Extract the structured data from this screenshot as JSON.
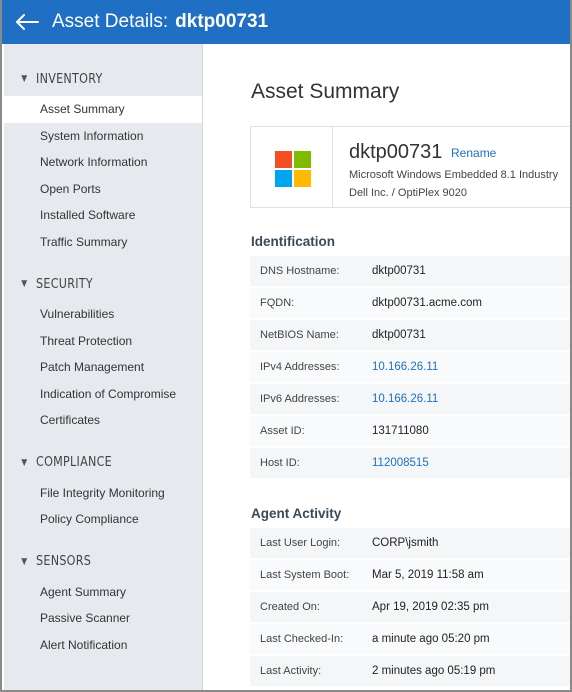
{
  "header": {
    "title_prefix": "Asset Details:",
    "asset_name": "dktp00731"
  },
  "sidebar": {
    "sections": [
      {
        "label": "INVENTORY",
        "items": [
          "Asset Summary",
          "System Information",
          "Network Information",
          "Open Ports",
          "Installed Software",
          "Traffic Summary"
        ]
      },
      {
        "label": "SECURITY",
        "items": [
          "Vulnerabilities",
          "Threat Protection",
          "Patch Management",
          "Indication of Compromise",
          "Certificates"
        ]
      },
      {
        "label": "COMPLIANCE",
        "items": [
          "File Integrity Monitoring",
          "Policy Compliance"
        ]
      },
      {
        "label": "SENSORS",
        "items": [
          "Agent Summary",
          "Passive Scanner",
          "Alert Notification"
        ]
      }
    ],
    "active_item": "Asset Summary"
  },
  "main": {
    "heading": "Asset Summary",
    "asset": {
      "name": "dktp00731",
      "rename_label": "Rename",
      "os": "Microsoft Windows Embedded 8.1 Industry",
      "hardware": "Dell Inc. / OptiPlex 9020"
    },
    "identification": {
      "title": "Identification",
      "rows": [
        {
          "key": "DNS Hostname",
          "value": "dktp00731",
          "link": false
        },
        {
          "key": "FQDN",
          "value": "dktp00731.acme.com",
          "link": false
        },
        {
          "key": "NetBIOS Name",
          "value": "dktp00731",
          "link": false
        },
        {
          "key": "IPv4 Addresses",
          "value": "10.166.26.11",
          "link": true
        },
        {
          "key": "IPv6 Addresses",
          "value": "10.166.26.11",
          "link": true
        },
        {
          "key": "Asset ID",
          "value": "131711080",
          "link": false
        },
        {
          "key": "Host ID",
          "value": "112008515",
          "link": true
        }
      ]
    },
    "agent_activity": {
      "title": "Agent Activity",
      "rows": [
        {
          "key": "Last User Login",
          "value": "CORP\\jsmith",
          "link": false
        },
        {
          "key": "Last System Boot",
          "value": "Mar 5, 2019 11:58 am",
          "link": false
        },
        {
          "key": "Created On",
          "value": "Apr 19, 2019 02:35 pm",
          "link": false
        },
        {
          "key": "Last Checked-In",
          "value": "a minute ago 05:20 pm",
          "link": false
        },
        {
          "key": "Last Activity",
          "value": "2 minutes ago 05:19 pm",
          "link": false
        }
      ]
    }
  },
  "colors": {
    "brand": "#1f6fc4",
    "sidebar_bg": "#e6eaee",
    "win_red": "#f25022",
    "win_green": "#7fba00",
    "win_blue": "#00a4ef",
    "win_yellow": "#ffb900"
  },
  "icons": {
    "back": "arrow-left-icon",
    "section_toggle": "caret-down-icon",
    "os_logo": "windows-logo-icon"
  }
}
